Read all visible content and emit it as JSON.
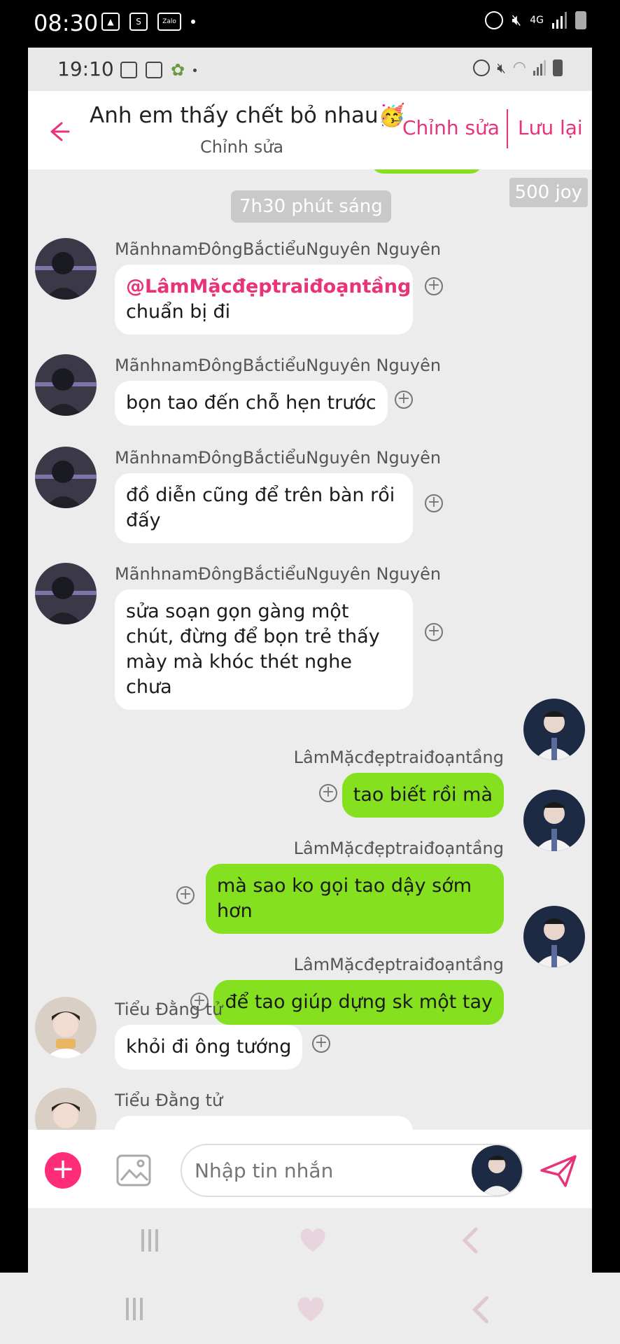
{
  "outer_status": {
    "time": "08:30",
    "left_icons": [
      "gallery-icon",
      "shopee-icon",
      "zalo-icon",
      "dot-icon"
    ],
    "zalo_label": "Zalo",
    "right_icons": [
      "alarm-icon",
      "mute-icon",
      "network-4g-icon",
      "signal-icon",
      "battery-icon"
    ],
    "network_label": "4G"
  },
  "inner_status": {
    "time": "19:10",
    "left_icons": [
      "shopee-icon",
      "gallery-icon",
      "settings-icon",
      "dot-icon"
    ],
    "right_icons": [
      "alarm-icon",
      "mute-icon",
      "wifi-icon",
      "signal-icon",
      "battery-icon"
    ]
  },
  "header": {
    "title": "Anh em thấy chết bỏ nhau🥳",
    "subtitle": "Chỉnh sửa",
    "edit_label": "Chỉnh sửa",
    "save_label": "Lưu lại"
  },
  "chat": {
    "badge": "500 joy",
    "time_label": "7h30 phút sáng",
    "messages": [
      {
        "direction": "in",
        "sender": "MãnhnamĐôngBắctiểuNguyên Nguyên",
        "mention": "@LâmMặcđẹptraiđoạntầng",
        "text": "chuẩn bị đi"
      },
      {
        "direction": "in",
        "sender": "MãnhnamĐôngBắctiểuNguyên Nguyên",
        "text": "bọn tao đến chỗ hẹn trước"
      },
      {
        "direction": "in",
        "sender": "MãnhnamĐôngBắctiểuNguyên Nguyên",
        "text": "đồ diễn cũng để trên bàn rồi đấy"
      },
      {
        "direction": "in",
        "sender": "MãnhnamĐôngBắctiểuNguyên Nguyên",
        "text": "sửa soạn gọn gàng một chút, đừng để bọn trẻ thấy mày mà khóc thét nghe chưa"
      },
      {
        "direction": "out",
        "sender": "LâmMặcđẹptraiđoạntầng",
        "text": "tao biết rồi mà"
      },
      {
        "direction": "out",
        "sender": "LâmMặcđẹptraiđoạntầng",
        "text": "mà sao ko gọi tao dậy sớm hơn"
      },
      {
        "direction": "out",
        "sender": "LâmMặcđẹptraiđoạntầng",
        "text": "để tao giúp dựng sk một tay"
      },
      {
        "direction": "in",
        "sender": "Tiểu Đằng tử",
        "text": "khỏi đi ông tướng"
      },
      {
        "direction": "in",
        "sender": "Tiểu Đằng tử",
        "text": ""
      }
    ]
  },
  "composer": {
    "placeholder": "Nhập tin nhắn"
  },
  "colors": {
    "accent": "#e8337a",
    "outgoing_bubble": "#85e01f",
    "incoming_bubble": "#ffffff",
    "chat_background": "#ececec"
  }
}
